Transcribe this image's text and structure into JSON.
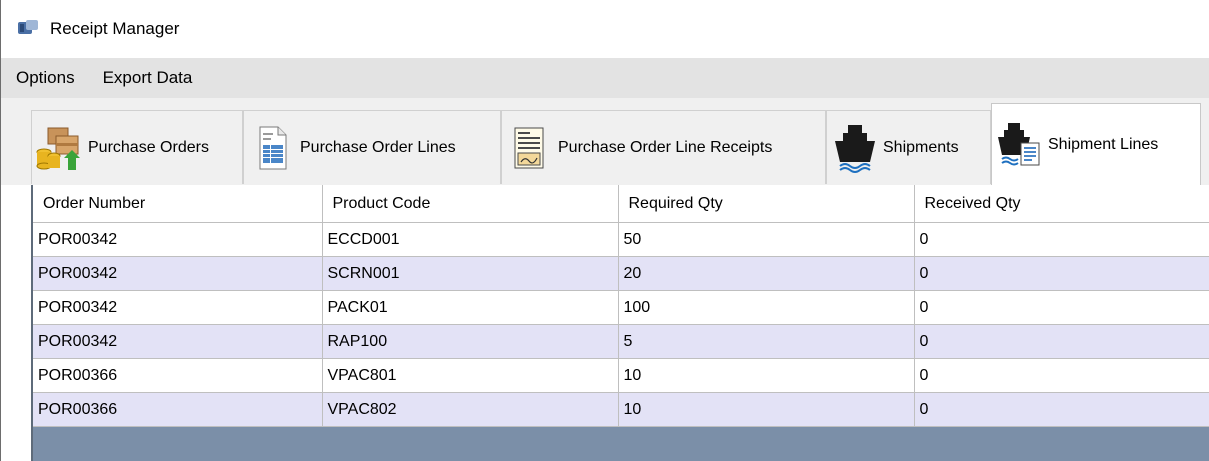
{
  "window": {
    "title": "Receipt Manager"
  },
  "menu": {
    "items": [
      "Options",
      "Export Data"
    ]
  },
  "tabs": [
    {
      "label": "Purchase Orders",
      "icon": "purchase-orders-icon",
      "active": false
    },
    {
      "label": "Purchase Order Lines",
      "icon": "document-lines-icon",
      "active": false
    },
    {
      "label": "Purchase Order Line Receipts",
      "icon": "receipt-icon",
      "active": false
    },
    {
      "label": "Shipments",
      "icon": "ship-icon",
      "active": false
    },
    {
      "label": "Shipment Lines",
      "icon": "ship-document-icon",
      "active": true
    }
  ],
  "grid": {
    "columns": [
      "Order Number",
      "Product Code",
      "Required Qty",
      "Received Qty"
    ],
    "rows": [
      [
        "POR00342",
        "ECCD001",
        "50",
        "0"
      ],
      [
        "POR00342",
        "SCRN001",
        "20",
        "0"
      ],
      [
        "POR00342",
        "PACK01",
        "100",
        "0"
      ],
      [
        "POR00342",
        "RAP100",
        "5",
        "0"
      ],
      [
        "POR00366",
        "VPAC801",
        "10",
        "0"
      ],
      [
        "POR00366",
        "VPAC802",
        "10",
        "0"
      ]
    ]
  },
  "colors": {
    "row_alt": "#e3e2f6",
    "grid_background": "#7b8fa8",
    "menu_background": "#e3e3e3"
  }
}
